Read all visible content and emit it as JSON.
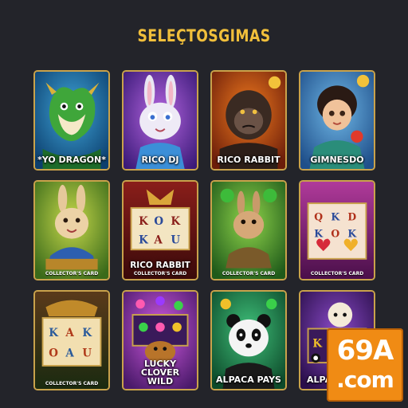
{
  "header": {
    "title": "SELEÇTOSGIMAS"
  },
  "cards": [
    {
      "label": "*YO DRAGON*",
      "theme": "dragon"
    },
    {
      "label": "RICO DJ",
      "theme": "rabbit-dj"
    },
    {
      "label": "RICO RABBIT",
      "theme": "gorilla"
    },
    {
      "label": "GIMNESDO",
      "theme": "girl"
    },
    {
      "sub": "COLLECTOR'S CARD",
      "theme": "rabbit-gold"
    },
    {
      "label": "RICO RABBIT",
      "sub": "COLLECTOR'S CARD",
      "theme": "slot-red"
    },
    {
      "sub": "COLLECTOR'S CARD",
      "theme": "rabbit-green"
    },
    {
      "sub": "COLLECTOR'S CARD",
      "theme": "slot-purple"
    },
    {
      "sub": "COLLECTOR'S CARD",
      "theme": "slot-jungle"
    },
    {
      "label": "LUCKY CLOVER WILD",
      "theme": "clover"
    },
    {
      "label": "ALPACA PAYS",
      "theme": "panda"
    },
    {
      "label": "ALPA",
      "theme": "alpaca"
    }
  ],
  "logo": {
    "line1": "69A",
    "line2": ".com",
    "color": "#f08b14"
  }
}
